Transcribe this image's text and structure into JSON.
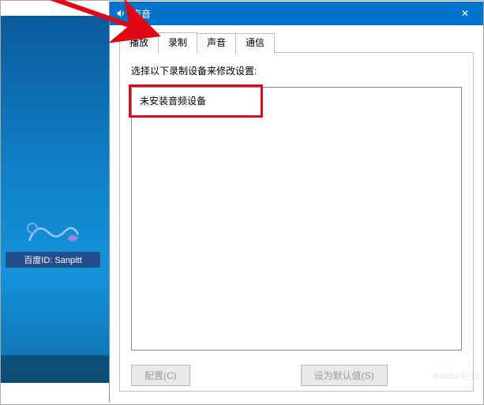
{
  "titlebar": {
    "title": "声音",
    "close_label": "✕"
  },
  "tabs": {
    "playback": "播放",
    "recording": "录制",
    "sound": "声音",
    "communication": "通信"
  },
  "panel": {
    "instruction": "选择以下录制设备来修改设置:",
    "no_device": "未安装音频设备"
  },
  "buttons": {
    "configure": "配置(C)",
    "set_default": "设为默认值(S)"
  },
  "watermark": {
    "label": "百度ID: Sanpitt"
  },
  "baidu_wm": "Baidu 经验"
}
